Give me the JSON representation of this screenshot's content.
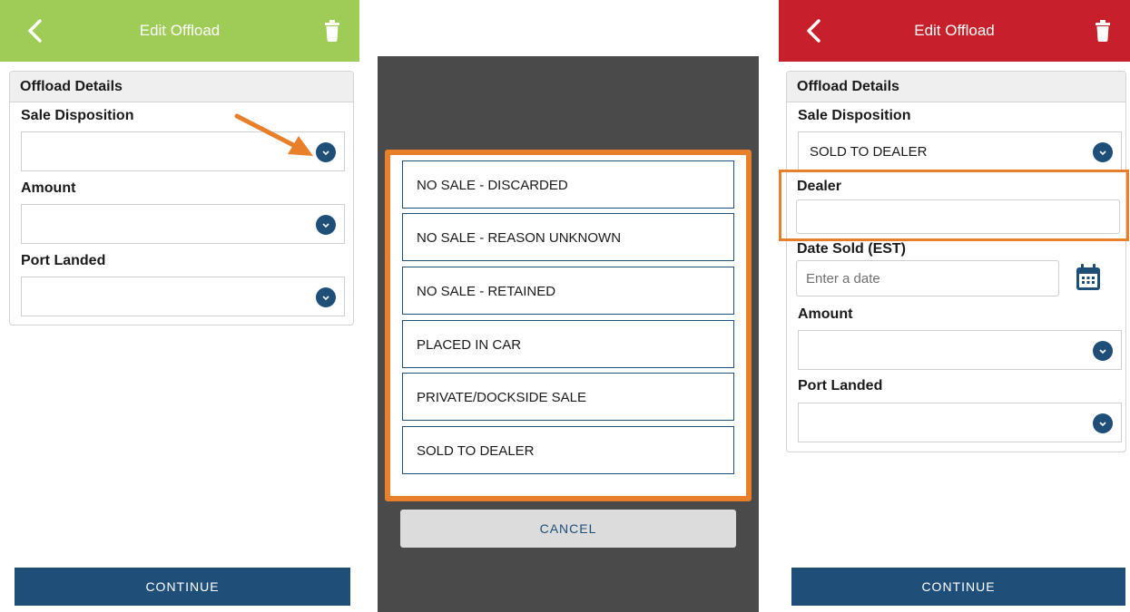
{
  "colors": {
    "green_header": "#9fcc56",
    "red_header": "#c8202a",
    "accent_orange": "#e87f2b",
    "primary_blue": "#1f4e79"
  },
  "screen1": {
    "header_title": "Edit Offload",
    "section_title": "Offload Details",
    "sale_disposition_label": "Sale Disposition",
    "sale_disposition_value": "",
    "amount_label": "Amount",
    "port_landed_label": "Port Landed",
    "continue_label": "CONTINUE"
  },
  "screen2": {
    "options": [
      "NO SALE - DISCARDED",
      "NO SALE - REASON UNKNOWN",
      "NO SALE - RETAINED",
      "PLACED IN CAR",
      "PRIVATE/DOCKSIDE SALE",
      "SOLD TO DEALER"
    ],
    "cancel_label": "CANCEL"
  },
  "screen3": {
    "header_title": "Edit Offload",
    "section_title": "Offload Details",
    "sale_disposition_label": "Sale Disposition",
    "sale_disposition_value": "SOLD TO DEALER",
    "dealer_label": "Dealer",
    "date_sold_label": "Date Sold (EST)",
    "date_placeholder": "Enter a date",
    "amount_label": "Amount",
    "port_landed_label": "Port Landed",
    "continue_label": "CONTINUE"
  }
}
